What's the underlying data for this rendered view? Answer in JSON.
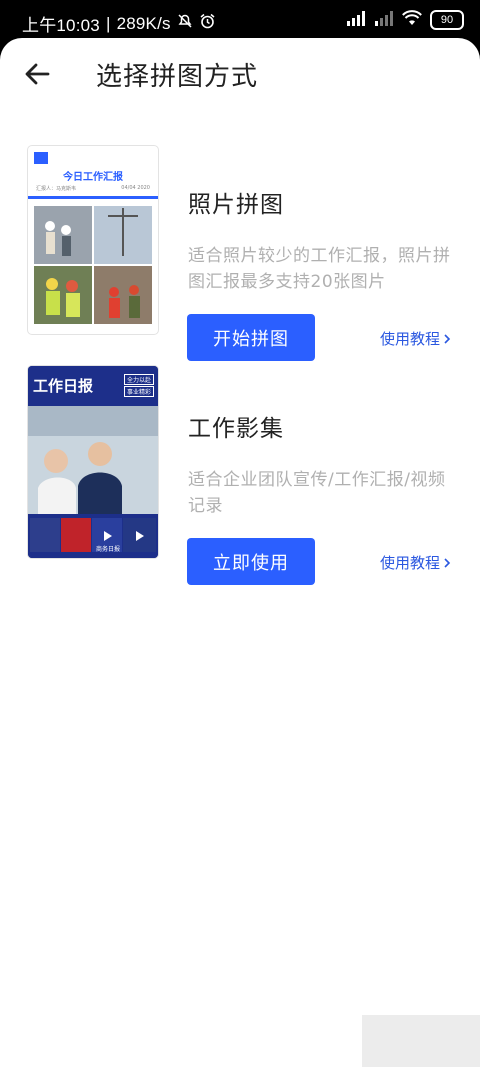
{
  "status": {
    "time": "上午10:03",
    "speed": "289K/s",
    "battery": "90"
  },
  "header": {
    "title": "选择拼图方式",
    "back_icon": "arrow-left-icon"
  },
  "colors": {
    "accent": "#2b5fff",
    "link": "#2b58e0",
    "desc": "#b0b0b0"
  },
  "cards": [
    {
      "title": "照片拼图",
      "desc": "适合照片较少的工作汇报，照片拼图汇报最多支持20张图片",
      "button": "开始拼图",
      "tutorial": "使用教程",
      "thumb": {
        "header": "今日工作汇报",
        "reporter": "汇报人：马克斯韦",
        "date": "04/04 2020"
      }
    },
    {
      "title": "工作影集",
      "desc": "适合企业团队宣传/工作汇报/视频记录",
      "button": "立即使用",
      "tutorial": "使用教程",
      "thumb": {
        "header": "工作日报",
        "tag1": "全力以赴",
        "tag2": "事业精彩",
        "mini4": "商务日报"
      }
    }
  ]
}
